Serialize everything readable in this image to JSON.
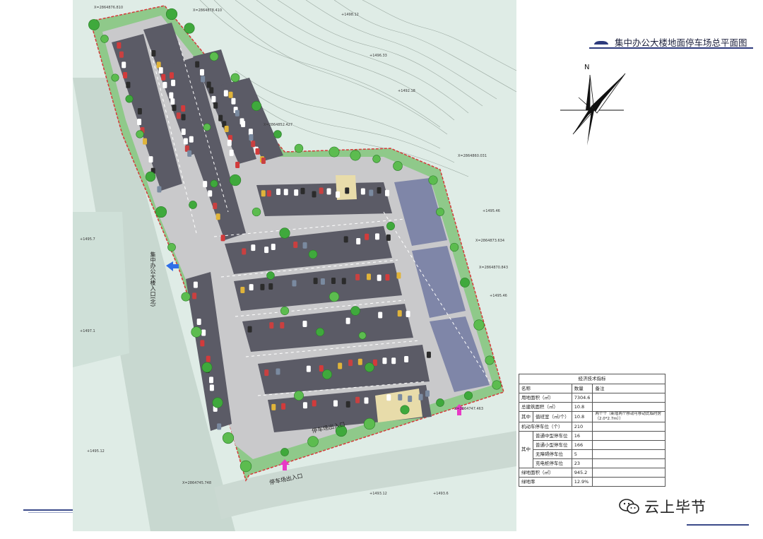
{
  "title": "集中办公大楼地面停车场总平面图",
  "north_label": "N",
  "watermark": "云上毕节",
  "plan_labels": {
    "north_entrance": "集中办公大楼入口(北)",
    "south_entrance": "停车场出入口",
    "south_entrance2": "停车场出入口",
    "southeast_entrance": "停车场出入口"
  },
  "table": {
    "caption": "经济技术指标",
    "headers": [
      "名称",
      "数量",
      "备注"
    ],
    "rows": [
      {
        "name": "用地面积（㎡）",
        "value": "7304.6",
        "note": ""
      },
      {
        "name": "总建筑面积（㎡）",
        "value": "10.8",
        "note": ""
      },
      {
        "group": "其中",
        "name": "值班室（㎡/个）",
        "value": "10.8",
        "note": "两个个（新增两个移动可移动式临时房（2.0*2.7m））"
      },
      {
        "name": "机动车停车位（个）",
        "value": "210",
        "note": ""
      },
      {
        "group": "其中",
        "name": "普通中型停车位",
        "value": "16",
        "note": ""
      },
      {
        "name": "普通小型停车位",
        "value": "166",
        "note": ""
      },
      {
        "name": "无障碍停车位",
        "value": "5",
        "note": ""
      },
      {
        "name": "充电桩停车位",
        "value": "23",
        "note": ""
      },
      {
        "name": "绿地面积（㎡）",
        "value": "945.2",
        "note": ""
      },
      {
        "name": "绿地率",
        "value": "12.9%",
        "note": ""
      }
    ]
  },
  "colors": {
    "site_border": "#d63a3a",
    "pavement": "#c9c9cb",
    "stall": "#5b5b66",
    "tree": "#3fa93c",
    "ground": "#dfece6",
    "entrance_blue": "#2f6fe8",
    "entrance_pink": "#e83ac6"
  }
}
